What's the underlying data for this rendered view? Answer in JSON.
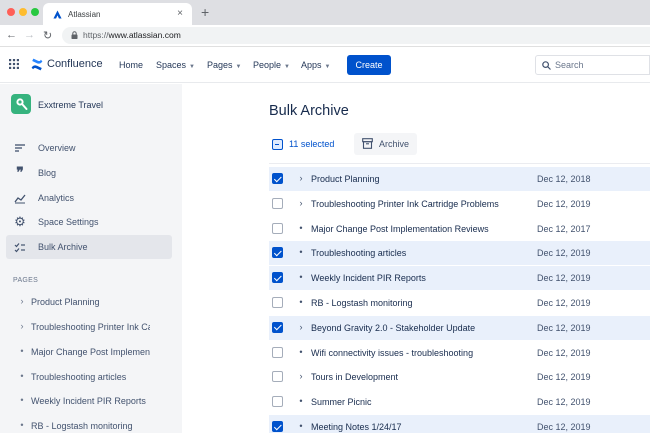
{
  "browser": {
    "tab_title": "Atlassian",
    "url_scheme": "https://",
    "url_host": "www.atlassian.com"
  },
  "header": {
    "product": "Confluence",
    "nav": [
      "Home",
      "Spaces",
      "Pages",
      "People",
      "Apps"
    ],
    "create_label": "Create",
    "search_placeholder": "Search"
  },
  "sidebar": {
    "space_name": "Exxtreme Travel",
    "items": [
      {
        "label": "Overview",
        "icon": "list-lines-icon"
      },
      {
        "label": "Blog",
        "icon": "quote-icon"
      },
      {
        "label": "Analytics",
        "icon": "chart-line-icon"
      },
      {
        "label": "Space Settings",
        "icon": "gear-icon"
      },
      {
        "label": "Bulk Archive",
        "icon": "checklist-icon",
        "active": true
      }
    ],
    "pages_heading": "PAGES",
    "tree": [
      {
        "label": "Product Planning",
        "mark": "›"
      },
      {
        "label": "Troubleshooting Printer Ink Cartridge Problems",
        "mark": "›"
      },
      {
        "label": "Major Change Post Implementation Reviews",
        "mark": "•"
      },
      {
        "label": "Troubleshooting articles",
        "mark": "•"
      },
      {
        "label": "Weekly Incident PIR Reports",
        "mark": "•"
      },
      {
        "label": "RB - Logstash monitoring",
        "mark": "•"
      }
    ]
  },
  "main": {
    "title": "Bulk Archive",
    "selected_count": "11 selected",
    "archive_label": "Archive",
    "rows": [
      {
        "title": "Product Planning",
        "date": "Dec 12, 2018",
        "mark": "›",
        "selected": true
      },
      {
        "title": "Troubleshooting Printer Ink Cartridge Problems",
        "date": "Dec 12, 2019",
        "mark": "›",
        "selected": false
      },
      {
        "title": "Major Change Post Implementation Reviews",
        "date": "Dec 12, 2017",
        "mark": "•",
        "selected": false
      },
      {
        "title": "Troubleshooting articles",
        "date": "Dec 12, 2019",
        "mark": "•",
        "selected": true
      },
      {
        "title": "Weekly Incident PIR Reports",
        "date": "Dec 12, 2019",
        "mark": "•",
        "selected": true
      },
      {
        "title": "RB - Logstash monitoring",
        "date": "Dec 12, 2019",
        "mark": "•",
        "selected": false
      },
      {
        "title": "Beyond Gravity 2.0 - Stakeholder Update",
        "date": "Dec 12, 2019",
        "mark": "›",
        "selected": true
      },
      {
        "title": "Wifi connectivity issues - troubleshooting",
        "date": "Dec 12, 2019",
        "mark": "•",
        "selected": false
      },
      {
        "title": "Tours in Development",
        "date": "Dec 12, 2019",
        "mark": "›",
        "selected": false
      },
      {
        "title": "Summer Picnic",
        "date": "Dec 12, 2019",
        "mark": "•",
        "selected": false
      },
      {
        "title": "Meeting Notes 1/24/17",
        "date": "Dec 12, 2019",
        "mark": "•",
        "selected": true
      }
    ]
  },
  "colors": {
    "brand_blue": "#0052CC",
    "selected_row": "#E9F0FB",
    "sidebar_bg": "#F4F5F7",
    "space_avatar": "#36B37E"
  }
}
